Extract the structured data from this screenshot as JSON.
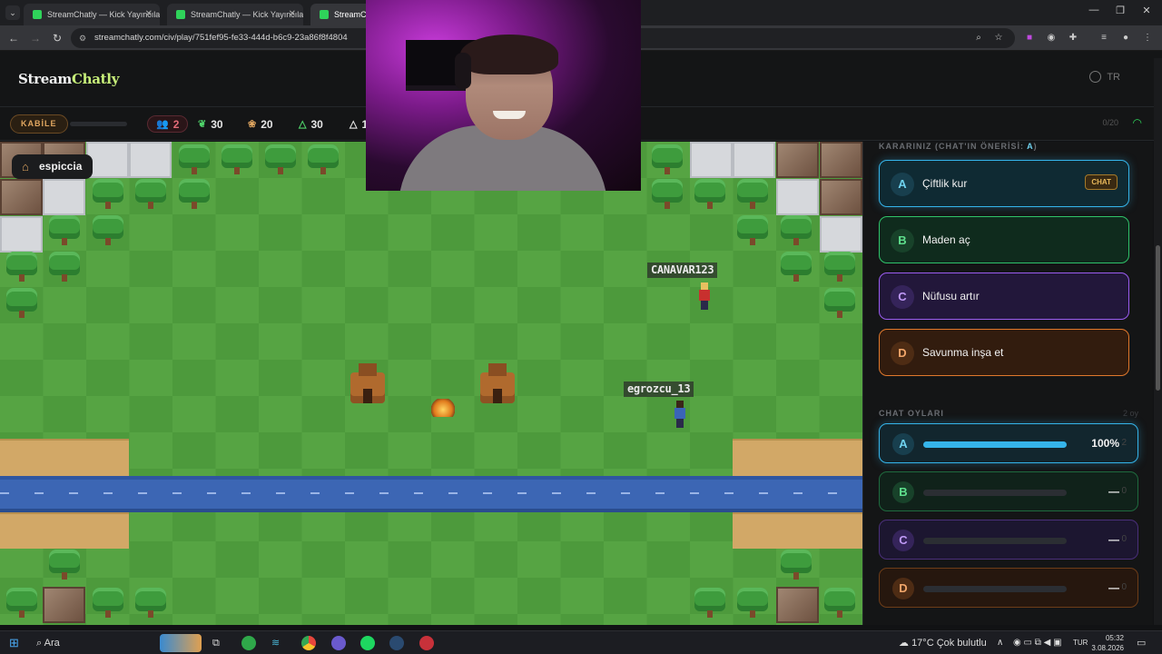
{
  "browser": {
    "tabs": [
      {
        "title": "StreamChatly — Kick Yayıncıları"
      },
      {
        "title": "StreamChatly — Kick Yayıncıları"
      },
      {
        "title": "StreamCha"
      }
    ],
    "url": "streamchatly.com/civ/play/751fef95-fe33-444d-b6c9-23a86f8f4804"
  },
  "site": {
    "logo_main": "Stream",
    "logo_accent": "Chatly",
    "language": "TR"
  },
  "stats": {
    "tribe_label": "KABİLE",
    "population": "2",
    "wood": "30",
    "food": "20",
    "stone": "30",
    "partial": "1",
    "counter": "0/20",
    "tribe_progress": 0
  },
  "game": {
    "player_tag": "espiccia",
    "units": [
      {
        "name": "CANAVAR123"
      },
      {
        "name": "egrozcu_13"
      }
    ]
  },
  "panel": {
    "decision_prefix": "KARARINIZ (CHAT'IN ÖNERİSİ: ",
    "decision_suggest": "A",
    "decision_suffix": ")",
    "options": [
      {
        "letter": "A",
        "label": "Çiftlik kur",
        "badge": "CHAT",
        "color": "#35b4ea"
      },
      {
        "letter": "B",
        "label": "Maden aç",
        "color": "#2fc26a"
      },
      {
        "letter": "C",
        "label": "Nüfusu artır",
        "color": "#9a5cf0"
      },
      {
        "letter": "D",
        "label": "Savunma inşa et",
        "color": "#e0782c"
      }
    ],
    "votes_title": "CHAT OYLARI",
    "votes_meta": "2 oy",
    "votes": [
      {
        "letter": "A",
        "display": "100%",
        "fraction": 1.0,
        "count": "2"
      },
      {
        "letter": "B",
        "display": "—",
        "fraction": 0,
        "count": "0"
      },
      {
        "letter": "C",
        "display": "—",
        "fraction": 0,
        "count": "0"
      },
      {
        "letter": "D",
        "display": "—",
        "fraction": 0,
        "count": "0"
      }
    ]
  },
  "taskbar": {
    "search": "Ara",
    "weather": "17°C  Çok bulutlu",
    "lang": "TUR",
    "time": "05:32",
    "date": "3.08.2026"
  }
}
